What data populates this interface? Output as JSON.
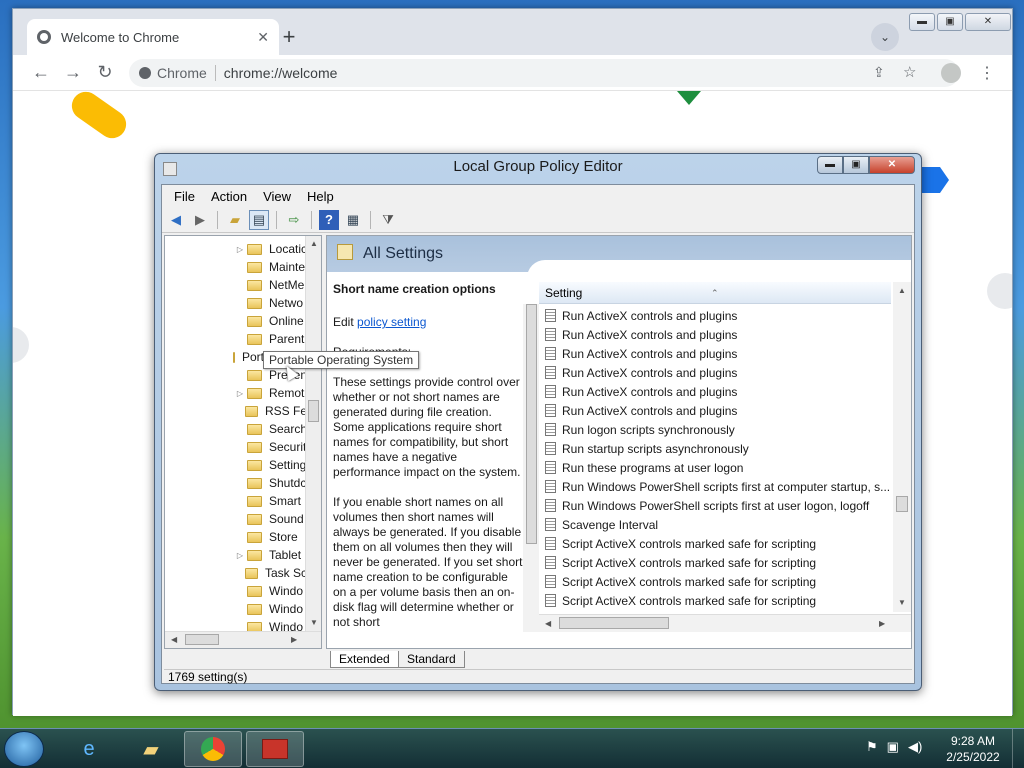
{
  "chrome": {
    "tab_title": "Welcome to Chrome",
    "tab_close": "✕",
    "new_tab": "+",
    "tab_search": "⌄",
    "site_chip": "Chrome",
    "url": "chrome://welcome",
    "win_min": "▬",
    "win_max": "▣",
    "win_close": "✕"
  },
  "gpe": {
    "title": "Local Group Policy Editor",
    "menu": [
      "File",
      "Action",
      "View",
      "Help"
    ],
    "tree_items": [
      {
        "label": "Locatic",
        "expander": "▷"
      },
      {
        "label": "Mainte",
        "expander": ""
      },
      {
        "label": "NetMe",
        "expander": ""
      },
      {
        "label": "Netwo",
        "expander": ""
      },
      {
        "label": "Online",
        "expander": ""
      },
      {
        "label": "Parent",
        "expander": ""
      },
      {
        "label": "Portable Operating System",
        "expander": ""
      },
      {
        "label": "Presen",
        "expander": ""
      },
      {
        "label": "Remot",
        "expander": "▷"
      },
      {
        "label": "RSS Fe",
        "expander": ""
      },
      {
        "label": "Search",
        "expander": ""
      },
      {
        "label": "Securit",
        "expander": ""
      },
      {
        "label": "Setting",
        "expander": ""
      },
      {
        "label": "Shutdc",
        "expander": ""
      },
      {
        "label": "Smart",
        "expander": ""
      },
      {
        "label": "Sound",
        "expander": ""
      },
      {
        "label": "Store",
        "expander": ""
      },
      {
        "label": "Tablet",
        "expander": "▷"
      },
      {
        "label": "Task Sc",
        "expander": ""
      },
      {
        "label": "Windo",
        "expander": ""
      },
      {
        "label": "Windo",
        "expander": ""
      },
      {
        "label": "Windo",
        "expander": ""
      }
    ],
    "tooltip": "Portable Operating System",
    "pane_title": "All Settings",
    "desc_heading": "Short name creation options",
    "desc_edit_prefix": "Edit ",
    "desc_edit_link": "policy setting",
    "desc_requirements": "Requirements:",
    "desc_p1": "These settings provide control over whether or not short names are generated during file creation. Some applications require short names for compatibility, but short names have a negative performance impact on the system.",
    "desc_p2": "If you enable short names on all volumes then short names will always be generated.  If you disable them on all volumes then they will never be generated.  If you set short name creation to be configurable on a per volume basis then an on-disk flag will determine whether or not short",
    "list_header": "Setting",
    "list_items": [
      "Run ActiveX controls and plugins",
      "Run ActiveX controls and plugins",
      "Run ActiveX controls and plugins",
      "Run ActiveX controls and plugins",
      "Run ActiveX controls and plugins",
      "Run ActiveX controls and plugins",
      "Run logon scripts synchronously",
      "Run startup scripts asynchronously",
      "Run these programs at user logon",
      "Run Windows PowerShell scripts first at computer startup, s...",
      "Run Windows PowerShell scripts first at user logon, logoff",
      "Scavenge Interval",
      "Script ActiveX controls marked safe for scripting",
      "Script ActiveX controls marked safe for scripting",
      "Script ActiveX controls marked safe for scripting",
      "Script ActiveX controls marked safe for scripting"
    ],
    "tab_extended": "Extended",
    "tab_standard": "Standard",
    "status": "1769 setting(s)"
  },
  "taskbar": {
    "time": "9:28 AM",
    "date": "2/25/2022"
  }
}
